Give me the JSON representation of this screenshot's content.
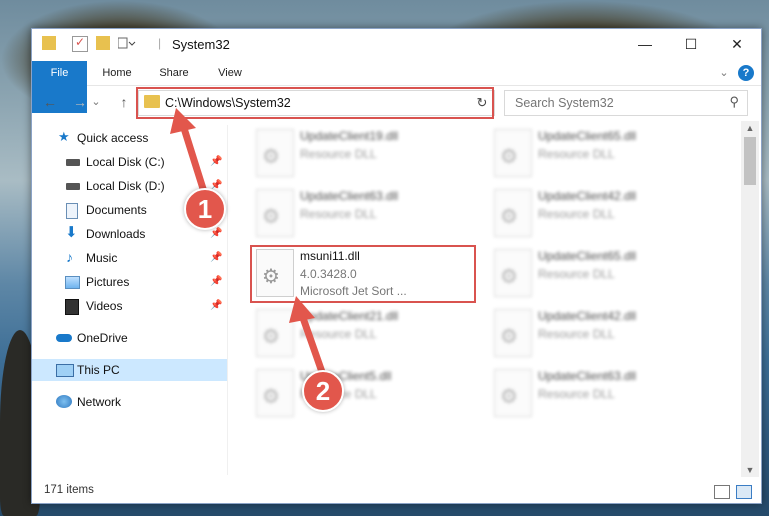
{
  "window": {
    "title": "System32",
    "controls": {
      "minimize": "—",
      "maximize": "☐",
      "close": "✕"
    }
  },
  "ribbon": {
    "tabs": [
      {
        "label": "File",
        "active": true
      },
      {
        "label": "Home"
      },
      {
        "label": "Share"
      },
      {
        "label": "View"
      }
    ],
    "expand_icon": "chevron-down-icon",
    "help_icon": "help-icon",
    "expand_glyph": "⌄",
    "help_glyph": "?"
  },
  "nav": {
    "back_glyph": "←",
    "forward_glyph": "→",
    "recent_glyph": "⌄",
    "up_glyph": "↑",
    "address_path": "C:\\Windows\\System32",
    "address_chevron": "⌄",
    "refresh_glyph": "↻",
    "search_placeholder": "Search System32",
    "search_glyph": "⚲"
  },
  "sidebar": {
    "items": [
      {
        "label": "Quick access",
        "icon": "star-icon",
        "pinned": false
      },
      {
        "label": "Local Disk (C:)",
        "icon": "drive-icon",
        "pinned": true
      },
      {
        "label": "Local Disk (D:)",
        "icon": "drive-icon",
        "pinned": true
      },
      {
        "label": "Documents",
        "icon": "documents-icon",
        "pinned": true
      },
      {
        "label": "Downloads",
        "icon": "download-arrow-icon",
        "pinned": true
      },
      {
        "label": "Music",
        "icon": "music-note-icon",
        "pinned": true
      },
      {
        "label": "Pictures",
        "icon": "pictures-icon",
        "pinned": true
      },
      {
        "label": "Videos",
        "icon": "film-icon",
        "pinned": true
      },
      {
        "label": "OneDrive",
        "icon": "cloud-icon",
        "pinned": false
      },
      {
        "label": "This PC",
        "icon": "monitor-icon",
        "pinned": false,
        "selected": true
      },
      {
        "label": "Network",
        "icon": "network-icon",
        "pinned": false
      }
    ],
    "pin_glyph": "📌"
  },
  "files": {
    "left_column": [
      {
        "name": "UpdateClient19.dll",
        "l2": "Resource DLL",
        "blurred": true
      },
      {
        "name": "UpdateClient63.dll",
        "l2": "Resource DLL",
        "blurred": true
      },
      {
        "name": "msuni11.dll",
        "l2": "4.0.3428.0",
        "l3": "Microsoft Jet Sort ...",
        "highlighted": true
      },
      {
        "name": "UpdateClient21.dll",
        "l2": "Resource DLL",
        "blurred": true
      },
      {
        "name": "UpdateClient5.dll",
        "l2": "Resource DLL",
        "blurred": true
      }
    ],
    "right_column": [
      {
        "name": "UpdateClient65.dll",
        "l2": "Resource DLL",
        "blurred": true
      },
      {
        "name": "UpdateClient42.dll",
        "l2": "Resource DLL",
        "blurred": true
      },
      {
        "name": "UpdateClient65.dll",
        "l2": "Resource DLL",
        "blurred": true
      },
      {
        "name": "UpdateClient42.dll",
        "l2": "Resource DLL",
        "blurred": true
      },
      {
        "name": "UpdateClient63.dll",
        "l2": "Resource DLL",
        "blurred": true
      }
    ],
    "icon_glyph": "⚙"
  },
  "scrollbar": {
    "up_glyph": "▲",
    "down_glyph": "▼"
  },
  "status": {
    "item_count": "171 items"
  },
  "annotations": {
    "badge1": "1",
    "badge2": "2",
    "color": "#e2574c"
  },
  "colors": {
    "accent": "#1979ca",
    "selection": "#cce8ff",
    "highlight_box": "#d9534f"
  }
}
